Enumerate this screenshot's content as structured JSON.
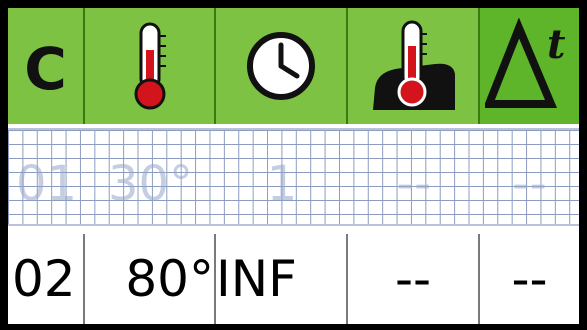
{
  "header": {
    "col1_label": "C",
    "icons": [
      "thermometer-icon",
      "clock-icon",
      "probe-thermometer-icon",
      "delta-t-icon"
    ]
  },
  "ghost_row": {
    "c": "01",
    "temp": "30°",
    "time": "1",
    "probe": "--",
    "delta": "--"
  },
  "values": {
    "c": "02",
    "temp": "80°",
    "time": "INF",
    "probe": "--",
    "delta": "--"
  },
  "colors": {
    "header_bg": "#7dc242",
    "header_active_bg": "#5fb52a",
    "thermometer_red": "#d4141c",
    "grid_line": "#8c9cc0"
  }
}
